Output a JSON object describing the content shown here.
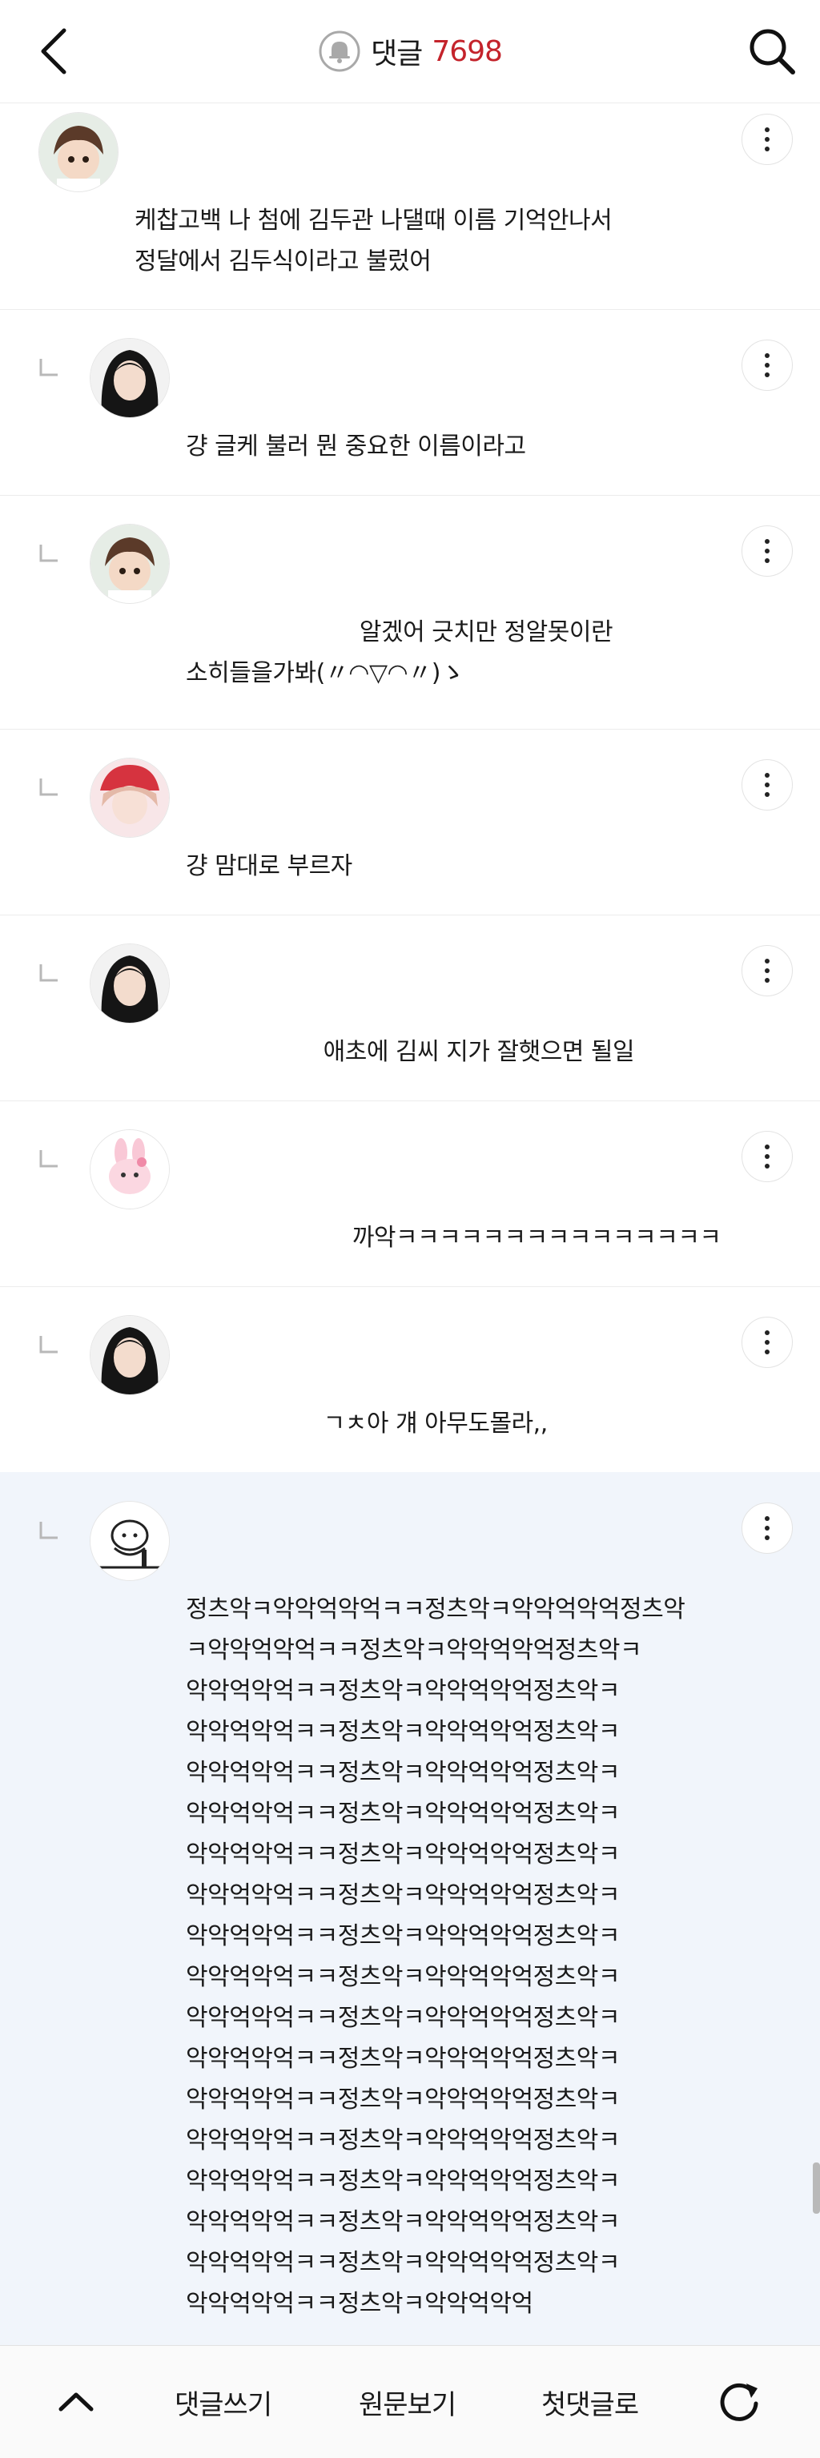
{
  "header": {
    "title": "댓글",
    "count": "7698"
  },
  "comments": [
    {
      "text": "케찹고백 나 첨에 김두관 나댈때 이름 기억안나서\n정달에서 김두식이라고 불렀어"
    },
    {
      "text": "걍 글케 불러 뭔 중요한 이름이라고"
    },
    {
      "text": "                        알겠어 긋치만 정알못이란\n소히들을가봐(〃◠▽◠〃)ゝ"
    },
    {
      "text": "걍 맘대로 부르자"
    },
    {
      "text": "                   애초에 김씨 지가 잘햇으면 될일"
    },
    {
      "text": "                       까악ㅋㅋㅋㅋㅋㅋㅋㅋㅋㅋㅋㅋㅋㅋㅋ"
    },
    {
      "text": "                   ㄱㅊ아 걔 아무도몰라,,"
    },
    {
      "text": "정츠악ㅋ악악억악억ㅋㅋ정츠악ㅋ악악억악억정츠악\nㅋ악악억악억ㅋㅋ정츠악ㅋ악악억악억정츠악ㅋ\n악악억악억ㅋㅋ정츠악ㅋ악악억악억정츠악ㅋ\n악악억악억ㅋㅋ정츠악ㅋ악악억악억정츠악ㅋ\n악악억악억ㅋㅋ정츠악ㅋ악악억악억정츠악ㅋ\n악악억악억ㅋㅋ정츠악ㅋ악악억악억정츠악ㅋ\n악악억악억ㅋㅋ정츠악ㅋ악악억악억정츠악ㅋ\n악악억악억ㅋㅋ정츠악ㅋ악악억악억정츠악ㅋ\n악악억악억ㅋㅋ정츠악ㅋ악악억악억정츠악ㅋ\n악악억악억ㅋㅋ정츠악ㅋ악악억악억정츠악ㅋ\n악악억악억ㅋㅋ정츠악ㅋ악악억악억정츠악ㅋ\n악악억악억ㅋㅋ정츠악ㅋ악악억악억정츠악ㅋ\n악악억악억ㅋㅋ정츠악ㅋ악악억악억정츠악ㅋ\n악악억악억ㅋㅋ정츠악ㅋ악악억악억정츠악ㅋ\n악악억악억ㅋㅋ정츠악ㅋ악악억악억정츠악ㅋ\n악악억악억ㅋㅋ정츠악ㅋ악악억악억정츠악ㅋ\n악악억악억ㅋㅋ정츠악ㅋ악악억악억정츠악ㅋ\n악악억악억ㅋㅋ정츠악ㅋ악악억악억"
    }
  ],
  "bottom_bar": {
    "write_label": "댓글쓰기",
    "original_label": "원문보기",
    "first_label": "첫댓글로"
  },
  "colors": {
    "count": "#c4232b",
    "highlight_bg": "#f1f5fb"
  }
}
